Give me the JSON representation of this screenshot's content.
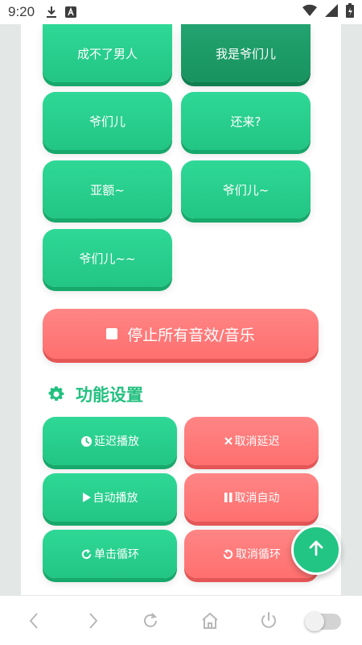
{
  "status_bar": {
    "time": "9:20",
    "icons": [
      "download-icon",
      "a-box-icon",
      "wifi-icon",
      "signal-icon",
      "battery-icon"
    ]
  },
  "sound_buttons": [
    {
      "label": "成不了男人",
      "active": false
    },
    {
      "label": "我是爷们儿",
      "active": true
    },
    {
      "label": "爷们儿",
      "active": false
    },
    {
      "label": "还来?",
      "active": false
    },
    {
      "label": "亚额~",
      "active": false
    },
    {
      "label": "爷们儿~",
      "active": false
    },
    {
      "label": "爷们儿~~",
      "active": false
    }
  ],
  "stop_button": {
    "label": "停止所有音效/音乐"
  },
  "settings": {
    "title": "功能设置",
    "delay_play": "延迟播放",
    "cancel_delay": "取消延迟",
    "auto_play": "自动播放",
    "cancel_auto": "取消自动",
    "single_loop": "单击循环",
    "cancel_loop": "取消循环"
  },
  "colors": {
    "green": "#22c584",
    "green_active": "#18935f",
    "red": "#ff7474",
    "title_green": "#22c07f"
  },
  "bottom_nav": {
    "icons": [
      "back-icon",
      "forward-icon",
      "refresh-icon",
      "home-icon",
      "power-icon",
      "toggle-switch"
    ]
  }
}
